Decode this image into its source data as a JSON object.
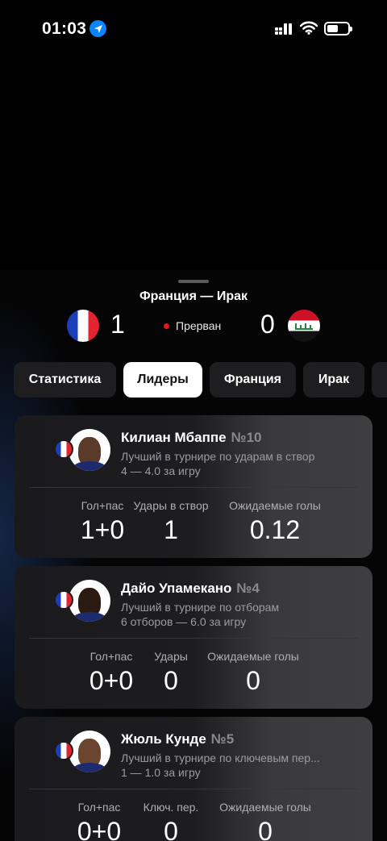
{
  "status_bar": {
    "time": "01:03"
  },
  "match": {
    "title": "Франция — Ирак",
    "home_score": "1",
    "away_score": "0",
    "status": "Прерван"
  },
  "tabs": [
    {
      "label": "Статистика"
    },
    {
      "label": "Лидеры"
    },
    {
      "label": "Франция"
    },
    {
      "label": "Ирак"
    }
  ],
  "players": [
    {
      "name": "Килиан Мбаппе",
      "number": "№10",
      "desc1": "Лучший в турнире по ударам в створ",
      "desc2": "4 — 4.0 за игру",
      "stats": [
        {
          "label": "Гол+пас",
          "value": "1+0"
        },
        {
          "label": "Удары в створ",
          "value": "1"
        },
        {
          "label": "Ожидаемые голы",
          "value": "0.12"
        }
      ]
    },
    {
      "name": "Дайо Упамекано",
      "number": "№4",
      "desc1": "Лучший в турнире по отборам",
      "desc2": "6 отборов — 6.0 за игру",
      "stats": [
        {
          "label": "Гол+пас",
          "value": "0+0"
        },
        {
          "label": "Удары",
          "value": "0"
        },
        {
          "label": "Ожидаемые голы",
          "value": "0"
        }
      ]
    },
    {
      "name": "Жюль Кунде",
      "number": "№5",
      "desc1": "Лучший в турнире по ключевым пер...",
      "desc2": "1 — 1.0 за игру",
      "stats": [
        {
          "label": "Гол+пас",
          "value": "0+0"
        },
        {
          "label": "Ключ. пер.",
          "value": "0"
        },
        {
          "label": "Ожидаемые голы",
          "value": "0"
        }
      ]
    }
  ]
}
